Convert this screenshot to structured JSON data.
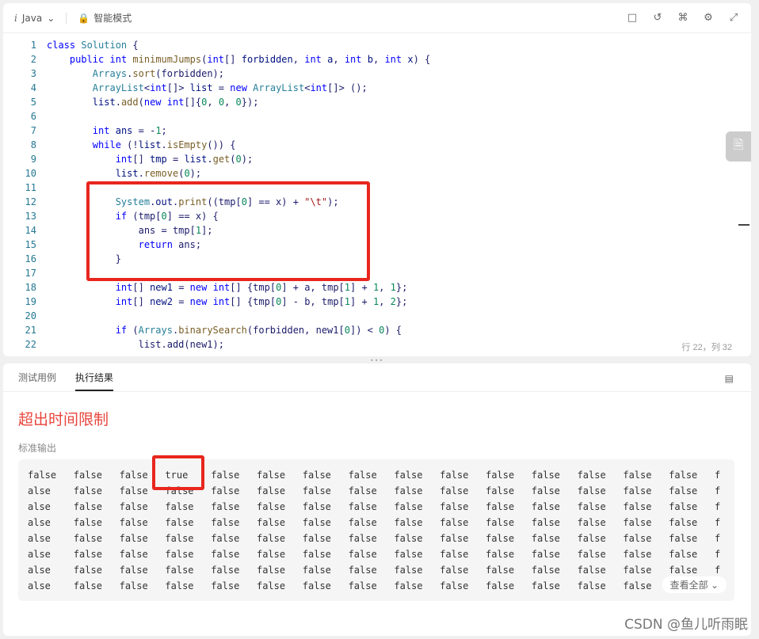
{
  "toolbar": {
    "lang_icon": "i",
    "lang": "Java",
    "mode": "智能模式",
    "icons": [
      "bookmark-icon",
      "reset-icon",
      "command-icon",
      "gear-icon",
      "expand-icon"
    ]
  },
  "code_lines": [
    {
      "n": "1",
      "html": "<span class='kw'>class</span> <span class='ty'>Solution</span> {"
    },
    {
      "n": "2",
      "html": "    <span class='kw'>public</span> <span class='kw'>int</span> <span class='fn'>minimumJumps</span>(<span class='kw'>int</span>[] <span class='var'>forbidden</span>, <span class='kw'>int</span> <span class='var'>a</span>, <span class='kw'>int</span> <span class='var'>b</span>, <span class='kw'>int</span> <span class='var'>x</span>) {"
    },
    {
      "n": "3",
      "html": "        <span class='ty'>Arrays</span>.<span class='fn'>sort</span>(forbidden);"
    },
    {
      "n": "4",
      "html": "        <span class='ty'>ArrayList</span>&lt;<span class='kw'>int</span>[]&gt; <span class='var'>list</span> = <span class='kw'>new</span> <span class='ty'>ArrayList</span>&lt;<span class='kw'>int</span>[]&gt; ();"
    },
    {
      "n": "5",
      "html": "        <span class='var'>list</span>.<span class='fn'>add</span>(<span class='kw'>new</span> <span class='kw'>int</span>[]{<span class='num'>0</span>, <span class='num'>0</span>, <span class='num'>0</span>});"
    },
    {
      "n": "6",
      "html": ""
    },
    {
      "n": "7",
      "html": "        <span class='kw'>int</span> <span class='var'>ans</span> = -<span class='num'>1</span>;"
    },
    {
      "n": "8",
      "html": "        <span class='kw'>while</span> (!<span class='var'>list</span>.<span class='fn'>isEmpty</span>()) {"
    },
    {
      "n": "9",
      "html": "            <span class='kw'>int</span>[] <span class='var'>tmp</span> = <span class='var'>list</span>.<span class='fn'>get</span>(<span class='num'>0</span>);"
    },
    {
      "n": "10",
      "html": "            <span class='var'>list</span>.<span class='fn'>remove</span>(<span class='num'>0</span>);"
    },
    {
      "n": "11",
      "html": ""
    },
    {
      "n": "12",
      "html": "            <span class='ty'>System</span>.<span class='var'>out</span>.<span class='fn'>print</span>((tmp[<span class='num'>0</span>] == x) + <span class='str'>\"\\t\"</span>);"
    },
    {
      "n": "13",
      "html": "            <span class='kw'>if</span> (tmp[<span class='num'>0</span>] == x) {"
    },
    {
      "n": "14",
      "html": "                ans = tmp[<span class='num'>1</span>];"
    },
    {
      "n": "15",
      "html": "                <span class='kw'>return</span> ans;"
    },
    {
      "n": "16",
      "html": "            }"
    },
    {
      "n": "17",
      "html": ""
    },
    {
      "n": "18",
      "html": "            <span class='kw'>int</span>[] <span class='var'>new1</span> = <span class='kw'>new</span> <span class='kw'>int</span>[] {tmp[<span class='num'>0</span>] + a, tmp[<span class='num'>1</span>] + <span class='num'>1</span>, <span class='num'>1</span>};"
    },
    {
      "n": "19",
      "html": "            <span class='kw'>int</span>[] <span class='var'>new2</span> = <span class='kw'>new</span> <span class='kw'>int</span>[] {tmp[<span class='num'>0</span>] - b, tmp[<span class='num'>1</span>] + <span class='num'>1</span>, <span class='num'>2</span>};"
    },
    {
      "n": "20",
      "html": ""
    },
    {
      "n": "21",
      "html": "            <span class='kw'>if</span> (<span class='ty'>Arrays</span>.<span class='fn'>binarySearch</span>(forbidden, new1[<span class='num'>0</span>]) &lt; <span class='num'>0</span>) {"
    },
    {
      "n": "22",
      "html": "                list.add(new1);"
    }
  ],
  "status": "行 22，列 32",
  "tabs": [
    "测试用例",
    "执行结果"
  ],
  "result_title": "超出时间限制",
  "stdout_label": "标准输出",
  "output_rows": [
    "false   false   false   true    false   false   false   false   false   false   false   false   false   false   false   f",
    "alse    false   false   false   false   false   false   false   false   false   false   false   false   false   false   f",
    "alse    false   false   false   false   false   false   false   false   false   false   false   false   false   false   f",
    "alse    false   false   false   false   false   false   false   false   false   false   false   false   false   false   f",
    "alse    false   false   false   false   false   false   false   false   false   false   false   false   false   false   f",
    "alse    false   false   false   false   false   false   false   false   false   false   false   false   false   false   f",
    "alse    false   false   false   false   false   false   false   false   false   false   false   false   false   false   f",
    "alse    false   false   false   false   false   false   false   false   false   false   false   false   false"
  ],
  "see_all": "查看全部",
  "watermark": "CSDN @鱼儿听雨眠"
}
